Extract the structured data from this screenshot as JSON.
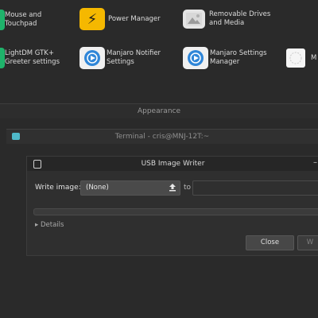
{
  "settings": {
    "row1": [
      {
        "label_line1": "Mouse and",
        "label_line2": "Touchpad",
        "icon": "mouse-icon"
      },
      {
        "label_line1": "Power Manager",
        "label_line2": "",
        "icon": "power-icon"
      },
      {
        "label_line1": "Removable Drives",
        "label_line2": "and Media",
        "icon": "drive-icon"
      }
    ],
    "row2": [
      {
        "label_line1": "LightDM GTK+",
        "label_line2": "Greeter settings",
        "icon": "lightdm-icon"
      },
      {
        "label_line1": "Manjaro Notifier",
        "label_line2": "Settings",
        "icon": "manjaro-notifier-icon"
      },
      {
        "label_line1": "Manjaro Settings",
        "label_line2": "Manager",
        "icon": "manjaro-settings-icon"
      },
      {
        "label_line1": "M",
        "label_line2": "",
        "icon": "mouse-settings-icon"
      }
    ],
    "section_title": "Appearance"
  },
  "terminal": {
    "title": "Terminal - cris@MNJ-12T:~"
  },
  "usb_writer": {
    "title": "USB Image Writer",
    "write_label": "Write image:",
    "image_value": "(None)",
    "to_label": "to",
    "details_label": "Details",
    "close_label": "Close",
    "write_button_label": "W"
  },
  "colors": {
    "accent_yellow": "#f5b800",
    "accent_green": "#1fb36b",
    "manjaro_blue": "#2f86d8",
    "terminal_icon": "#4fb8c8"
  }
}
